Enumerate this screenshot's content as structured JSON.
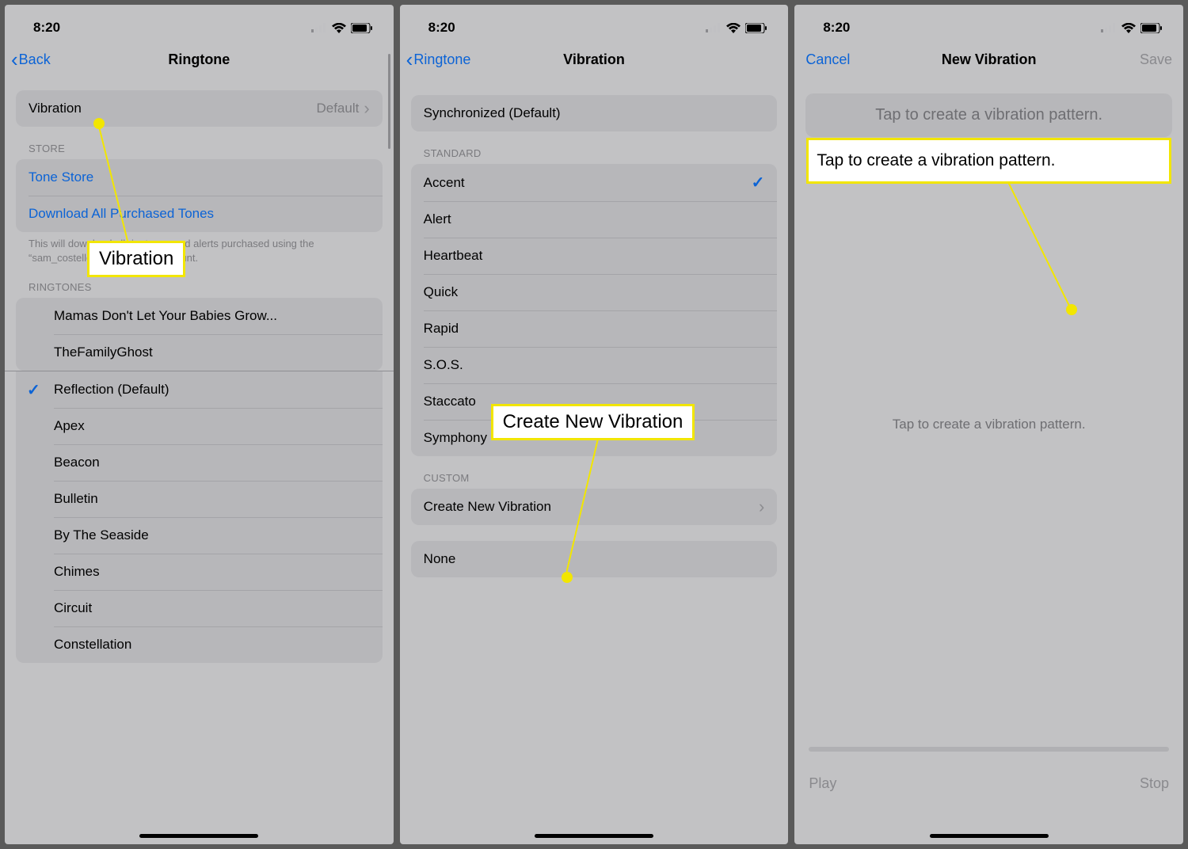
{
  "status": {
    "time": "8:20"
  },
  "screen1": {
    "back": "Back",
    "title": "Ringtone",
    "vibration": {
      "label": "Vibration",
      "value": "Default"
    },
    "storeHeader": "STORE",
    "toneStore": "Tone Store",
    "download": "Download All Purchased Tones",
    "downloadNote": "This will download all ringtones and alerts purchased using the “sam_costello@yahoo.com” account.",
    "ringtonesHeader": "RINGTONES",
    "custom": [
      "Mamas Don't Let Your Babies Grow...",
      "TheFamilyGhost"
    ],
    "defaultTone": "Reflection (Default)",
    "tones": [
      "Apex",
      "Beacon",
      "Bulletin",
      "By The Seaside",
      "Chimes",
      "Circuit",
      "Constellation"
    ],
    "callout": "Vibration"
  },
  "screen2": {
    "back": "Ringtone",
    "title": "Vibration",
    "syncDefault": "Synchronized (Default)",
    "standardHeader": "STANDARD",
    "standard": [
      "Accent",
      "Alert",
      "Heartbeat",
      "Quick",
      "Rapid",
      "S.O.S.",
      "Staccato",
      "Symphony"
    ],
    "selected": "Accent",
    "customHeader": "CUSTOM",
    "createNew": "Create New Vibration",
    "none": "None",
    "callout": "Create New Vibration"
  },
  "screen3": {
    "cancel": "Cancel",
    "title": "New Vibration",
    "save": "Save",
    "tapPrompt": "Tap to create a vibration pattern.",
    "centerPrompt": "Tap to create a vibration pattern.",
    "play": "Play",
    "stop": "Stop",
    "callout": "Tap to create a vibration pattern."
  }
}
